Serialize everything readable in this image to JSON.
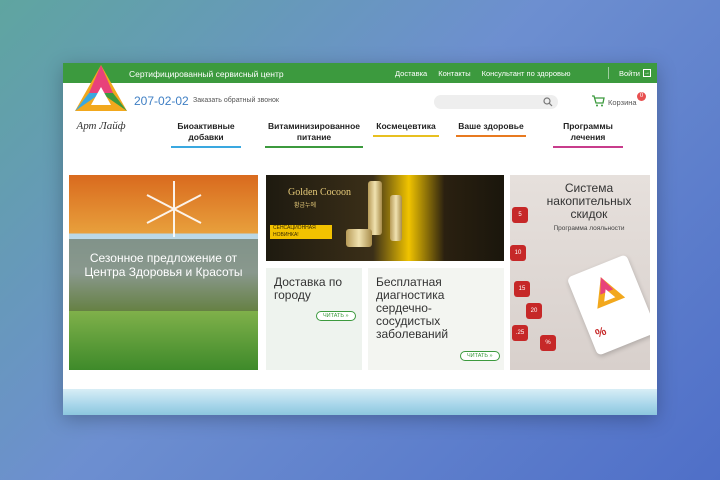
{
  "topbar": {
    "tagline": "Сертифицированный сервисный центр",
    "links": [
      "Доставка",
      "Контакты",
      "Консультант по здоровью"
    ],
    "login": "Войти"
  },
  "logo": {
    "text": "Арт Лайф"
  },
  "header": {
    "phone": "207-02-02",
    "callback": "Заказать обратный звонок",
    "search_placeholder": "",
    "cart_label": "Корзина",
    "cart_count": "0"
  },
  "nav": [
    {
      "label": "Биоактивные добавки",
      "color": "#3aa8e0"
    },
    {
      "label": "Витаминизированное питание",
      "color": "#3c9a3e"
    },
    {
      "label": "Космецевтика",
      "color": "#e8c020"
    },
    {
      "label": "Ваше здоровье",
      "color": "#e87a20"
    },
    {
      "label": "Программы лечения",
      "color": "#c83c8c"
    }
  ],
  "tiles": {
    "season": "Сезонное предложение от Центра Здоровья и Красоты",
    "cocoon_brand": "Golden Cocoon",
    "cocoon_sub": "황금누에",
    "cocoon_new": "СЕНСАЦИОННАЯ НОВИНКА!",
    "delivery_title": "Доставка по городу",
    "delivery_btn": "ЧИТАТЬ »",
    "diag_title": "Бесплатная диагностика сердечно-сосудистых заболеваний",
    "diag_btn": "ЧИТАТЬ »",
    "discount_title": "Система накопительных скидок",
    "discount_sub": "Программа лояльности",
    "card_pct": "%",
    "dice": [
      "5",
      "10",
      "15",
      "20",
      ".25",
      "%"
    ]
  },
  "colors": {
    "brand_green": "#3c9a3e",
    "phone_blue": "#3f7fc4"
  }
}
